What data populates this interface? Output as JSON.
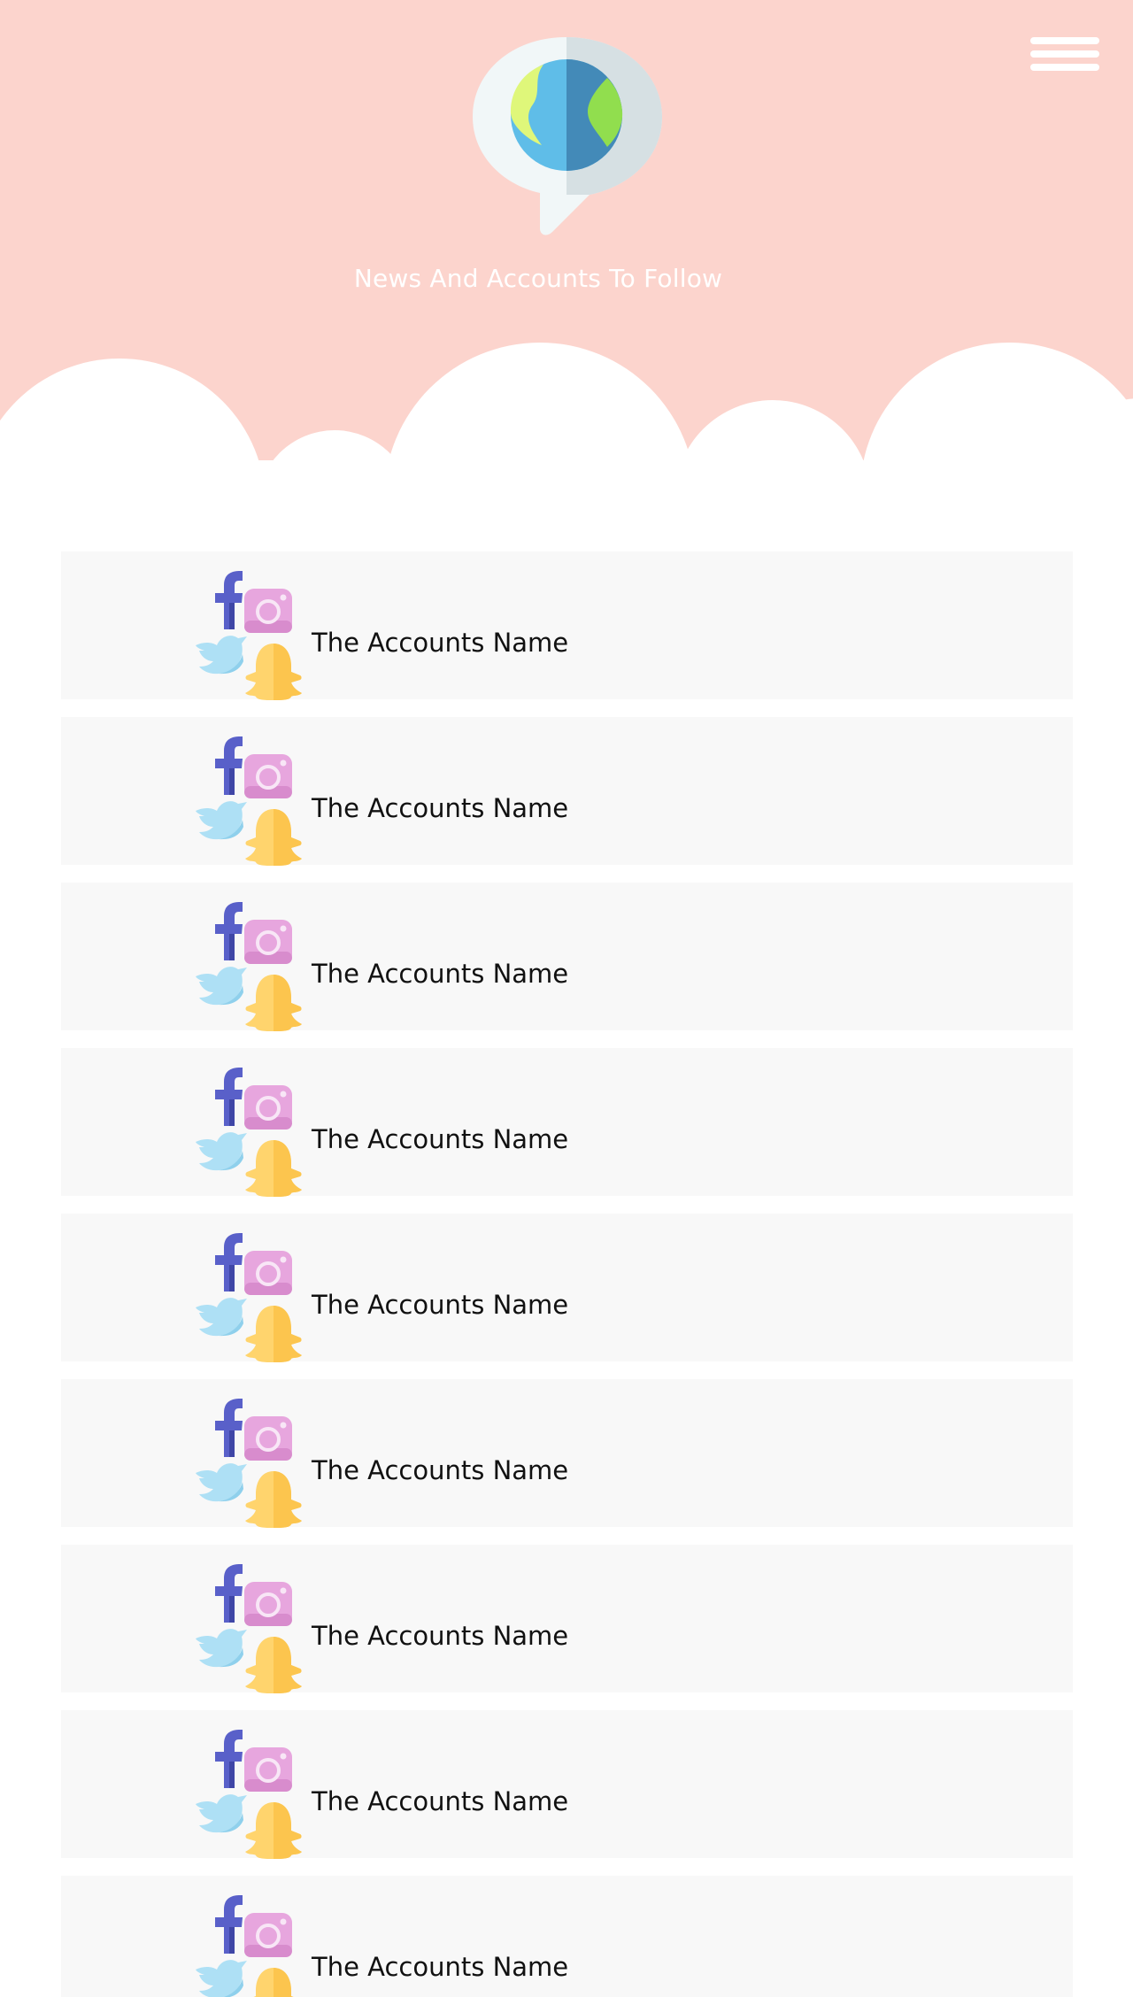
{
  "header": {
    "title": "News And Accounts To Follow",
    "background_color": "#fcd4cd",
    "logo_icon": "globe-chat-bubble-icon",
    "menu_icon": "hamburger-menu-icon"
  },
  "accounts": {
    "item_icons": [
      "facebook-icon",
      "instagram-icon",
      "twitter-icon",
      "snapchat-icon"
    ],
    "items": [
      {
        "name": "The Accounts Name"
      },
      {
        "name": "The Accounts Name"
      },
      {
        "name": "The Accounts Name"
      },
      {
        "name": "The Accounts Name"
      },
      {
        "name": "The Accounts Name"
      },
      {
        "name": "The Accounts Name"
      },
      {
        "name": "The Accounts Name"
      },
      {
        "name": "The Accounts Name"
      },
      {
        "name": "The Accounts Name"
      }
    ]
  },
  "colors": {
    "card_background": "#f8f8f8",
    "facebook": "#5960c9",
    "instagram": "#e7a6de",
    "twitter": "#aee0f5",
    "snapchat": "#ffd46d"
  }
}
